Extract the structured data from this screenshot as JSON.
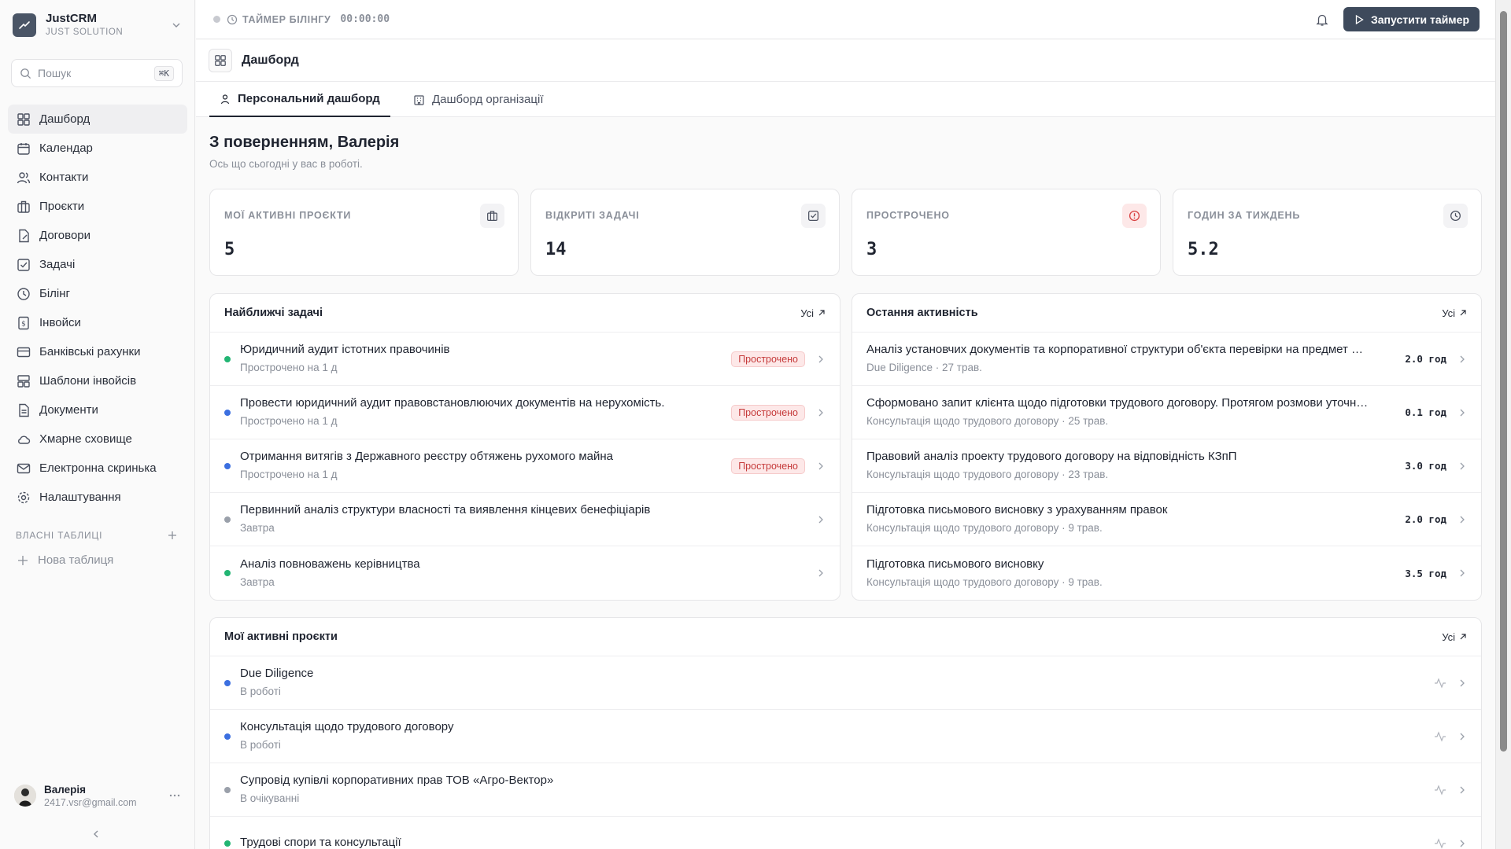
{
  "brand": {
    "name": "JustCRM",
    "subtitle": "JUST SOLUTION"
  },
  "search": {
    "placeholder": "Пошук",
    "shortcut": "⌘K"
  },
  "nav": [
    {
      "label": "Дашборд",
      "icon": "dashboard-icon",
      "active": true
    },
    {
      "label": "Календар",
      "icon": "calendar-icon"
    },
    {
      "label": "Контакти",
      "icon": "contacts-icon"
    },
    {
      "label": "Проєкти",
      "icon": "briefcase-icon"
    },
    {
      "label": "Договори",
      "icon": "contract-icon"
    },
    {
      "label": "Задачі",
      "icon": "tasks-icon"
    },
    {
      "label": "Білінг",
      "icon": "clock-icon"
    },
    {
      "label": "Інвойси",
      "icon": "invoice-icon"
    },
    {
      "label": "Банківські рахунки",
      "icon": "bank-card-icon"
    },
    {
      "label": "Шаблони інвойсів",
      "icon": "template-icon"
    },
    {
      "label": "Документи",
      "icon": "document-icon"
    },
    {
      "label": "Хмарне сховище",
      "icon": "cloud-icon"
    },
    {
      "label": "Електронна скринька",
      "icon": "mail-icon"
    },
    {
      "label": "Налаштування",
      "icon": "gear-icon"
    }
  ],
  "custom_tables": {
    "label": "ВЛАСНІ ТАБЛИЦІ",
    "new_label": "Нова таблиця"
  },
  "user": {
    "name": "Валерія",
    "email": "2417.vsr@gmail.com"
  },
  "topbar": {
    "timer_label": "ТАЙМЕР БІЛІНГУ",
    "timer_value": "00:00:00",
    "start_label": "Запустити таймер"
  },
  "page": {
    "title": "Дашборд"
  },
  "tabs": [
    {
      "label": "Персональний дашборд",
      "active": true
    },
    {
      "label": "Дашборд організації",
      "active": false
    }
  ],
  "greeting": {
    "title": "З поверненням, Валерія",
    "subtitle": "Ось що сьогодні у вас в роботі."
  },
  "stats": [
    {
      "label": "МОЇ АКТИВНІ ПРОЄКТИ",
      "value": "5",
      "icon": "briefcase-icon"
    },
    {
      "label": "ВІДКРИТІ ЗАДАЧІ",
      "value": "14",
      "icon": "check-square-icon"
    },
    {
      "label": "ПРОСТРОЧЕНО",
      "value": "3",
      "icon": "alert-circle-icon"
    },
    {
      "label": "ГОДИН ЗА ТИЖДЕНЬ",
      "value": "5.2",
      "icon": "clock-icon"
    }
  ],
  "tasks": {
    "title": "Найближчі задачі",
    "all_label": "Усі",
    "items": [
      {
        "title": "Юридичний аудит істотних правочинів",
        "sub": "Прострочено на 1 д",
        "badge": "Прострочено",
        "dot": "#22b573"
      },
      {
        "title": "Провести юридичний аудит правовстановлюючих документів на нерухомість.",
        "sub": "Прострочено на 1 д",
        "badge": "Прострочено",
        "dot": "#3b6fe0"
      },
      {
        "title": "Отримання витягів з Державного реєстру обтяжень рухомого майна",
        "sub": "Прострочено на 1 д",
        "badge": "Прострочено",
        "dot": "#3b6fe0"
      },
      {
        "title": "Первинний аналіз структури власності та виявлення кінцевих бенефіціарів",
        "sub": "Завтра",
        "badge": "",
        "dot": "#9aa0aa"
      },
      {
        "title": "Аналіз повноважень керівництва",
        "sub": "Завтра",
        "badge": "",
        "dot": "#22b573"
      }
    ]
  },
  "activity": {
    "title": "Остання активність",
    "all_label": "Усі",
    "items": [
      {
        "title": "Аналіз установчих документів та корпоративної структури об'єкта перевірки на предмет …",
        "sub": "Due Diligence · 27 трав.",
        "hours": "2.0 год"
      },
      {
        "title": "Сформовано запит клієнта щодо підготовки трудового договору. Протягом розмови уточн…",
        "sub": "Консультація щодо трудового договору · 25 трав.",
        "hours": "0.1 год"
      },
      {
        "title": "Правовий аналіз проекту трудового договору на відповідність КЗпП",
        "sub": "Консультація щодо трудового договору · 23 трав.",
        "hours": "3.0 год"
      },
      {
        "title": "Підготовка письмового висновку з урахуванням правок",
        "sub": "Консультація щодо трудового договору · 9 трав.",
        "hours": "2.0 год"
      },
      {
        "title": "Підготовка письмового висновку",
        "sub": "Консультація щодо трудового договору · 9 трав.",
        "hours": "3.5 год"
      }
    ]
  },
  "projects": {
    "title": "Мої активні проєкти",
    "all_label": "Усі",
    "items": [
      {
        "title": "Due Diligence",
        "sub": "В роботі",
        "dot": "#3b6fe0"
      },
      {
        "title": "Консультація щодо трудового договору",
        "sub": "В роботі",
        "dot": "#3b6fe0"
      },
      {
        "title": "Супровід купівлі корпоративних прав ТОВ «Агро-Вектор»",
        "sub": "В очікуванні",
        "dot": "#9aa0aa"
      },
      {
        "title": "Трудові спори та консультації",
        "sub": "",
        "dot": "#22b573"
      }
    ]
  },
  "colors": {
    "accent": "#3e4a5c",
    "overdue": "#c53a3a",
    "blue": "#3b6fe0",
    "green": "#22b573",
    "gray": "#9aa0aa"
  }
}
